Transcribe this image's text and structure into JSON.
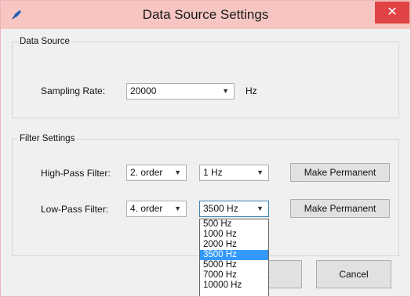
{
  "window": {
    "title": "Data Source Settings",
    "close_glyph": "✕",
    "app_icon": "blue-pen-icon"
  },
  "data_source": {
    "legend": "Data Source",
    "sampling_rate": {
      "label": "Sampling Rate:",
      "value": "20000",
      "unit": "Hz"
    }
  },
  "filter_settings": {
    "legend": "Filter Settings",
    "high_pass": {
      "label": "High-Pass Filter:",
      "order": "2. order",
      "freq": "1 Hz",
      "button": "Make Permanent"
    },
    "low_pass": {
      "label": "Low-Pass Filter:",
      "order": "4. order",
      "freq": "3500 Hz",
      "button": "Make Permanent"
    }
  },
  "dropdown": {
    "options": [
      "500 Hz",
      "1000 Hz",
      "2000 Hz",
      "3500 Hz",
      "5000 Hz",
      "7000 Hz",
      "10000 Hz"
    ],
    "selected": "3500 Hz"
  },
  "buttons": {
    "ok_partial": "K",
    "cancel": "Cancel"
  },
  "colors": {
    "titlebar": "#f7c6c2",
    "close": "#e04343",
    "selection": "#3399ff"
  }
}
